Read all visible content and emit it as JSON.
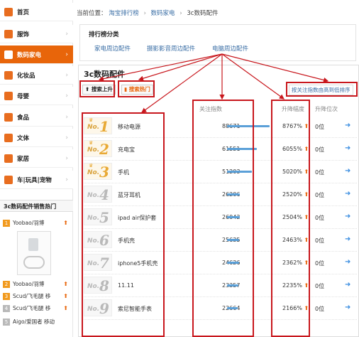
{
  "sidebar": {
    "items": [
      {
        "label": "首页"
      },
      {
        "label": "服饰"
      },
      {
        "label": "数码家电"
      },
      {
        "label": "化妆品"
      },
      {
        "label": "母婴"
      },
      {
        "label": "食品"
      },
      {
        "label": "文体"
      },
      {
        "label": "家居"
      },
      {
        "label": "车|玩具|宠物"
      }
    ],
    "active_index": 2,
    "chevron": "›",
    "hot_title": "3c数码配件销售热门",
    "hot_items": [
      {
        "num": "1",
        "name": "Yoobao/羽博"
      },
      {
        "num": "2",
        "name": "Yoobao/羽博"
      },
      {
        "num": "3",
        "name": "Scud/飞毛腿 移"
      },
      {
        "num": "4",
        "name": "Scud/飞毛腿 移"
      },
      {
        "num": "5",
        "name": "Aigo/爱国者 移动"
      }
    ]
  },
  "breadcrumb": {
    "prefix": "当前位置：",
    "items": [
      "淘宝排行榜",
      "数码家电",
      "3c数码配件"
    ],
    "separator": "›"
  },
  "categories": {
    "title": "排行榜分类",
    "links": [
      "家电周边配件",
      "摄影影音周边配件",
      "电脑周边配件"
    ]
  },
  "panel": {
    "title": "3c数码配件",
    "btn_search_up": "搜索上升",
    "btn_search_hot": "搜索热门",
    "sort_note": "按关注指数由高到低排序",
    "col_attention": "关注指数",
    "col_rise": "升降幅度",
    "col_pos": "升降位次"
  },
  "rows": [
    {
      "no": "No.",
      "rank": "1",
      "name": "移动电源",
      "attention": "88671",
      "attention_value": 88671,
      "rise": "8767%",
      "pos": "0位"
    },
    {
      "no": "No.",
      "rank": "2",
      "name": "充电宝",
      "attention": "61551",
      "attention_value": 61551,
      "rise": "6055%",
      "pos": "0位"
    },
    {
      "no": "No.",
      "rank": "3",
      "name": "手机",
      "attention": "51203",
      "attention_value": 51203,
      "rise": "5020%",
      "pos": "0位"
    },
    {
      "no": "No.",
      "rank": "4",
      "name": "蓝牙耳机",
      "attention": "26206",
      "attention_value": 26206,
      "rise": "2520%",
      "pos": "0位"
    },
    {
      "no": "No.",
      "rank": "5",
      "name": "ipad air保护套",
      "attention": "26042",
      "attention_value": 26042,
      "rise": "2504%",
      "pos": "0位"
    },
    {
      "no": "No.",
      "rank": "6",
      "name": "手机壳",
      "attention": "25635",
      "attention_value": 25635,
      "rise": "2463%",
      "pos": "0位"
    },
    {
      "no": "No.",
      "rank": "7",
      "name": "iphone5手机壳",
      "attention": "24626",
      "attention_value": 24626,
      "rise": "2362%",
      "pos": "0位"
    },
    {
      "no": "No.",
      "rank": "8",
      "name": "11.11",
      "attention": "23357",
      "attention_value": 23357,
      "rise": "2235%",
      "pos": "0位"
    },
    {
      "no": "No.",
      "rank": "9",
      "name": "索尼智能手表",
      "attention": "22664",
      "attention_value": 22664,
      "rise": "2166%",
      "pos": "0位"
    }
  ],
  "glyphs": {
    "up_arrow": "⬆",
    "right_arrow": "➜",
    "crown": "♛",
    "search_up_icon": "⬆",
    "search_hot_icon": "▮"
  },
  "colors": {
    "accent": "#e8650a",
    "link": "#3a6ea5",
    "annotation": "#c8171d",
    "bar": "#5ba0d8"
  }
}
